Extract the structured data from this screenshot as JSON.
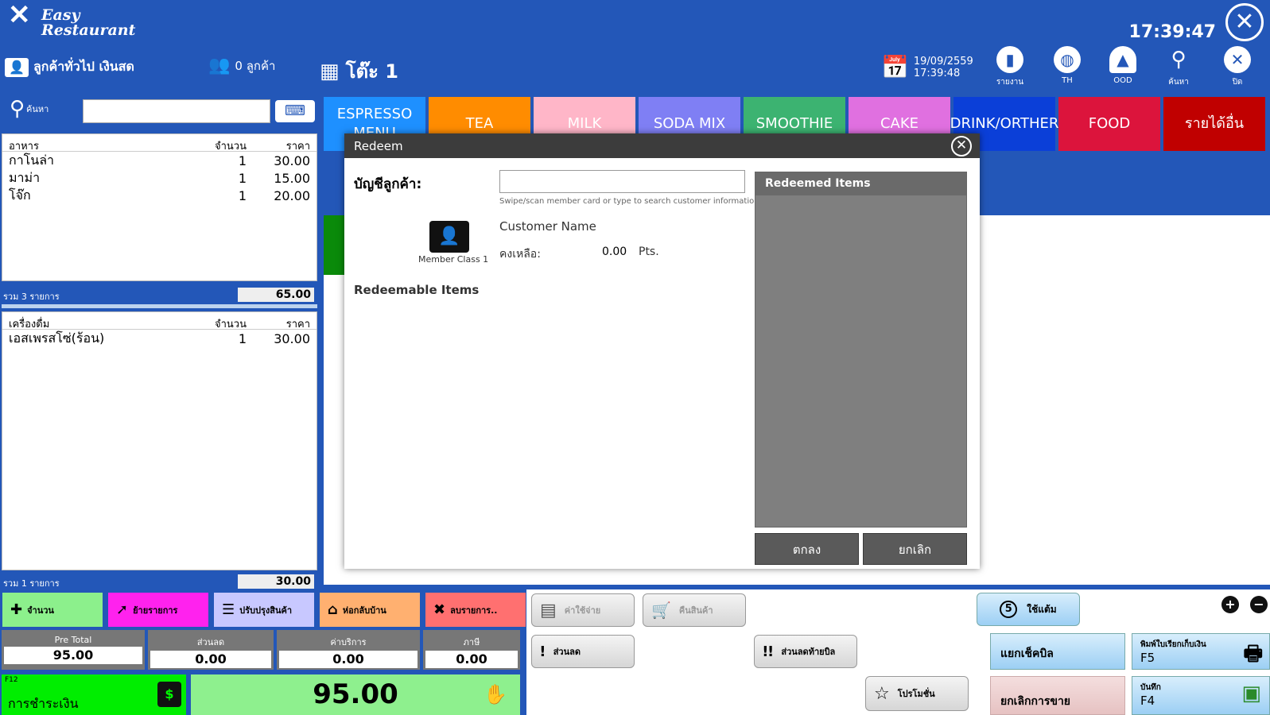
{
  "app": {
    "logo_line1": "Easy",
    "logo_line2": "Restaurant",
    "clock": "17:39:47"
  },
  "header": {
    "customer": "ลูกค้าทั่วไป เงินสด",
    "customer_count": "0 ลูกค้า",
    "table": "โต๊ะ 1",
    "date": "19/09/2559",
    "time": "17:39:48",
    "icons": [
      {
        "label": "รายงาน",
        "icon": "report-icon"
      },
      {
        "label": "TH",
        "icon": "globe-icon"
      },
      {
        "label": "OOD",
        "icon": "bell-icon"
      },
      {
        "label": "ค้นหา",
        "icon": "search-icon"
      },
      {
        "label": "ปิด",
        "icon": "close-icon"
      }
    ]
  },
  "search": {
    "label": "ค้นหา",
    "value": ""
  },
  "food_panel": {
    "headers": [
      "อาหาร",
      "จำนวน",
      "ราคา"
    ],
    "rows": [
      {
        "name": "กาโนล่า",
        "qty": "1",
        "price": "30.00"
      },
      {
        "name": "มาม่า",
        "qty": "1",
        "price": "15.00"
      },
      {
        "name": "โจ๊ก",
        "qty": "1",
        "price": "20.00"
      }
    ],
    "summary": "รวม 3 รายการ",
    "total": "65.00"
  },
  "drink_panel": {
    "headers": [
      "เครื่องดื่ม",
      "จำนวน",
      "ราคา"
    ],
    "rows": [
      {
        "name": "เอสเพรสโซ่(ร้อน)",
        "qty": "1",
        "price": "30.00"
      }
    ],
    "summary": "รวม 1 รายการ",
    "total": "30.00"
  },
  "categories": [
    {
      "label": "ESPRESSO MENU",
      "color": "#1e90ff"
    },
    {
      "label": "TEA",
      "color": "#ff8c00"
    },
    {
      "label": "MILK",
      "color": "#ffb6c8"
    },
    {
      "label": "SODA MIX",
      "color": "#7f7ff4"
    },
    {
      "label": "SMOOTHIE",
      "color": "#3cb371"
    },
    {
      "label": "CAKE",
      "color": "#e070e0"
    },
    {
      "label": "DRINK/ORTHER",
      "color": "#0b3fd8"
    },
    {
      "label": "FOOD",
      "color": "#dc143c"
    },
    {
      "label": "รายได้อื่น",
      "color": "#c00000"
    }
  ],
  "modal": {
    "title": "Redeem",
    "account_label": "บัญชีลูกค้า:",
    "account_value": "",
    "hint": "Swipe/scan member card or type to search customer information",
    "member_class": "Member Class 1",
    "customer_name": "Customer Name",
    "balance_label": "คงเหลือ:",
    "balance_value": "0.00",
    "balance_unit": "Pts.",
    "redeemable_title": "Redeemable Items",
    "redeemed_title": "Redeemed Items",
    "ok": "ตกลง",
    "cancel": "ยกเลิก"
  },
  "actions": [
    {
      "label": "จำนวน",
      "color": "#8cf08c"
    },
    {
      "label": "ย้ายรายการ",
      "color": "#ff22ee"
    },
    {
      "label": "ปรับปรุงสินค้า",
      "color": "#c8c8ff"
    },
    {
      "label": "ห่อกลับบ้าน",
      "color": "#ffb070"
    },
    {
      "label": "ลบรายการ..",
      "color": "#ff7070"
    }
  ],
  "totals": [
    {
      "label": "Pre Total",
      "value": "95.00"
    },
    {
      "label": "ส่วนลด",
      "value": "0.00"
    },
    {
      "label": "ค่าบริการ",
      "value": "0.00"
    },
    {
      "label": "ภาษี",
      "value": "0.00"
    }
  ],
  "payment": {
    "key": "F12",
    "label": "การชำระเงิน",
    "total": "95.00"
  },
  "right_buttons": {
    "expense": "ค่าใช้จ่าย",
    "return": "คืนสินค้า",
    "discount": "ส่วนลด",
    "bill_discount": "ส่วนลดท้ายบิล",
    "promotion": "โปรโมชั่น",
    "use_points": "ใช้แต้ม",
    "points_badge": "5",
    "split_bill": "แยกเช็คบิล",
    "print_bill": "พิมพ์ใบเรียกเก็บเงิน",
    "print_key": "F5",
    "cancel_sale": "ยกเลิกการขาย",
    "save": "บันทึก",
    "save_key": "F4"
  }
}
